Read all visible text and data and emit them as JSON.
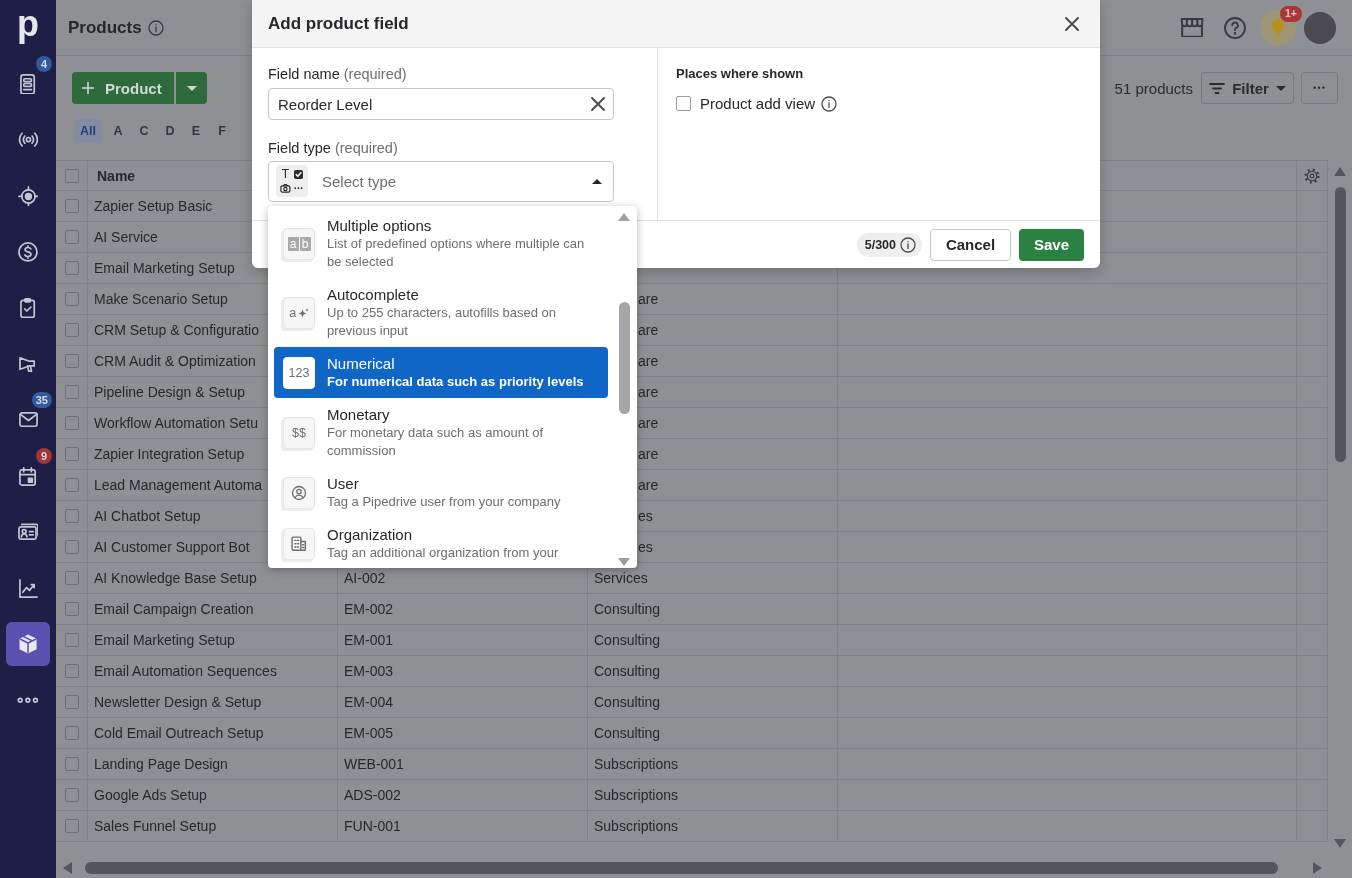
{
  "sidebar": {
    "logo": "p",
    "items": [
      {
        "selected": false,
        "badge": {
          "text": "4",
          "color": "#2f5c9f"
        }
      },
      {
        "selected": false
      },
      {
        "selected": false
      },
      {
        "selected": false
      },
      {
        "selected": false
      },
      {
        "selected": false
      },
      {
        "selected": false,
        "badge": {
          "text": "35",
          "color": "#2f5c9f"
        }
      },
      {
        "selected": false,
        "badge": {
          "text": "9",
          "color": "#a23636"
        }
      },
      {
        "selected": false
      },
      {
        "selected": false
      },
      {
        "selected": true
      },
      {
        "selected": false
      }
    ]
  },
  "header": {
    "title": "Products",
    "notification_badge": "1+"
  },
  "toolbar": {
    "add_button": {
      "label": "Product"
    },
    "count": "51 products",
    "filter_button": {
      "label": "Filter"
    }
  },
  "alphabet": [
    {
      "label": "All",
      "selected": true
    },
    {
      "label": "A",
      "selected": false
    },
    {
      "label": "C",
      "selected": false
    },
    {
      "label": "D",
      "selected": false
    },
    {
      "label": "E",
      "selected": false
    },
    {
      "label": "F",
      "selected": false
    }
  ],
  "table": {
    "header_checkbox": {
      "checked": false
    },
    "columns": [
      {
        "label": "Name"
      }
    ],
    "rows": [
      {
        "checked": false,
        "name": "Zapier Setup Basic"
      },
      {
        "checked": false,
        "name": "AI Service"
      },
      {
        "checked": false,
        "name": "Email Marketing Setup"
      },
      {
        "checked": false,
        "name": "Make Scenario Setup",
        "column_3_fragment": "are"
      },
      {
        "checked": false,
        "name": "CRM Setup & Configuratio",
        "column_3_fragment": "are"
      },
      {
        "checked": false,
        "name": "CRM Audit & Optimization",
        "column_3_fragment": "are"
      },
      {
        "checked": false,
        "name": "Pipeline Design & Setup",
        "column_3_fragment": "are"
      },
      {
        "checked": false,
        "name": "Workflow Automation Setu",
        "column_3_fragment": "are"
      },
      {
        "checked": false,
        "name": "Zapier Integration Setup",
        "column_3_fragment": "are"
      },
      {
        "checked": false,
        "name": "Lead Management Automa",
        "column_3_fragment": "are"
      },
      {
        "checked": false,
        "name": "AI Chatbot Setup",
        "column_3_fragment": "es"
      },
      {
        "checked": false,
        "name": "AI Customer Support Bot",
        "column_3_fragment": "es"
      },
      {
        "checked": false,
        "name": "AI Knowledge Base Setup",
        "column_2": "AI-002",
        "column_3": "Services"
      },
      {
        "checked": false,
        "name": "Email Campaign Creation",
        "column_2": "EM-002",
        "column_3": "Consulting"
      },
      {
        "checked": false,
        "name": "Email Marketing Setup",
        "column_2": "EM-001",
        "column_3": "Consulting"
      },
      {
        "checked": false,
        "name": "Email Automation Sequences",
        "column_2": "EM-003",
        "column_3": "Consulting"
      },
      {
        "checked": false,
        "name": "Newsletter Design & Setup",
        "column_2": "EM-004",
        "column_3": "Consulting"
      },
      {
        "checked": false,
        "name": "Cold Email Outreach Setup",
        "column_2": "EM-005",
        "column_3": "Consulting"
      },
      {
        "checked": false,
        "name": "Landing Page Design",
        "column_2": "WEB-001",
        "column_3": "Subscriptions"
      },
      {
        "checked": false,
        "name": "Google Ads Setup",
        "column_2": "ADS-002",
        "column_3": "Subscriptions"
      },
      {
        "checked": false,
        "name": "Sales Funnel Setup",
        "column_2": "FUN-001",
        "column_3": "Subscriptions"
      }
    ]
  },
  "dialog": {
    "title": "Add product field",
    "field_name": {
      "label": "Field name",
      "note": "(required)",
      "value": "Reorder Level"
    },
    "field_type": {
      "label": "Field type",
      "note": "(required)",
      "icon_letter": "T",
      "placeholder": "Select type",
      "expanded": true
    },
    "places": {
      "title": "Places where shown",
      "options": [
        {
          "label": "Product add view",
          "checked": false
        }
      ]
    },
    "counter": "5/300",
    "buttons": [
      {
        "label": "Cancel",
        "kind": "secondary"
      },
      {
        "label": "Save",
        "kind": "primary"
      }
    ]
  },
  "type_menu": {
    "options": [
      {
        "kind": "multiple",
        "title": "Multiple options",
        "description": "List of predefined options where multiple can be selected",
        "tile_letters": [
          "a",
          "b"
        ],
        "selected": false
      },
      {
        "kind": "autocomplete",
        "title": "Autocomplete",
        "description": "Up to 255 characters, autofills based on previous input",
        "tile_text": "a",
        "selected": false
      },
      {
        "kind": "numerical",
        "title": "Numerical",
        "description": "For numerical data such as priority levels",
        "tile_text": "123",
        "selected": true
      },
      {
        "kind": "monetary",
        "title": "Monetary",
        "description": "For monetary data such as amount of commission",
        "tile_text": "$$",
        "selected": false
      },
      {
        "kind": "user",
        "title": "User",
        "description": "Tag a Pipedrive user from your company",
        "selected": false
      },
      {
        "kind": "organization",
        "title": "Organization",
        "description": "Tag an additional organization from your",
        "selected": false
      }
    ]
  }
}
